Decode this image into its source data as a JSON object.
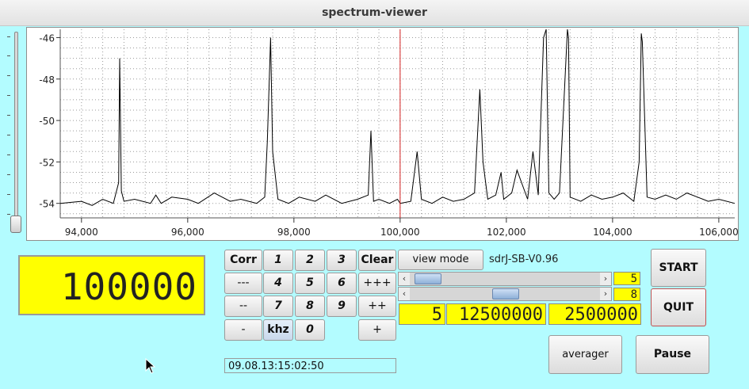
{
  "window": {
    "title": "spectrum-viewer"
  },
  "frequency_display": {
    "value": "100000"
  },
  "keypad": {
    "corr": "Corr",
    "k1": "1",
    "k2": "2",
    "k3": "3",
    "clear": "Clear",
    "dash3": "---",
    "k4": "4",
    "k5": "5",
    "k6": "6",
    "plus3": "+++",
    "dash2": "--",
    "k7": "7",
    "k8": "8",
    "k9": "9",
    "plus2": "++",
    "dash1": "-",
    "khz": "khz",
    "k0": "0",
    "plus1": "+"
  },
  "controls": {
    "view_mode": "view mode",
    "version": "sdrJ-SB-V0.96",
    "scroll1_value": "5",
    "scroll2_value": "8",
    "lcd_small": "5",
    "lcd_rate1": "12500000",
    "lcd_rate2": "2500000",
    "start": "START",
    "quit": "QUIT",
    "averager": "averager",
    "pause": "Pause",
    "datetime": "09.08.13:15:02:50"
  },
  "chart_data": {
    "type": "line",
    "xlim": [
      93600,
      106300
    ],
    "ylim": [
      -54.7,
      -45.6
    ],
    "x_ticks": [
      94000,
      96000,
      98000,
      100000,
      102000,
      104000,
      106000
    ],
    "x_tick_labels": [
      "94,000",
      "96,000",
      "98,000",
      "100,000",
      "102,000",
      "104,000",
      "106,000"
    ],
    "y_ticks": [
      -46,
      -48,
      -50,
      -52,
      -54
    ],
    "y_tick_labels": [
      "-46",
      "-48",
      "-50",
      "-52",
      "-54"
    ],
    "marker_x": 100000,
    "grid": true,
    "series": [
      {
        "x": [
          93600,
          94000,
          94200,
          94400,
          94600,
          94700,
          94720,
          94750,
          94800,
          95000,
          95300,
          95400,
          95500,
          95700,
          96000,
          96200,
          96500,
          96800,
          97000,
          97300,
          97450,
          97500,
          97560,
          97600,
          97700,
          97900,
          98100,
          98400,
          98600,
          98900,
          99200,
          99400,
          99450,
          99500,
          99600,
          99800,
          99950,
          100000,
          100200,
          100320,
          100400,
          100600,
          100800,
          101000,
          101200,
          101400,
          101500,
          101560,
          101650,
          101800,
          101900,
          101950,
          102100,
          102200,
          102400,
          102500,
          102600,
          102700,
          102750,
          102800,
          102900,
          103000,
          103150,
          103170,
          103200,
          103400,
          103600,
          103800,
          104000,
          104200,
          104400,
          104500,
          104540,
          104560,
          104650,
          104800,
          105000,
          105200,
          105400,
          105600,
          105800,
          106000,
          106300
        ],
        "y": [
          -54,
          -53.9,
          -54.1,
          -53.8,
          -54,
          -53,
          -47,
          -53.4,
          -53.9,
          -53.8,
          -54,
          -53.6,
          -54,
          -53.7,
          -53.8,
          -54,
          -53.5,
          -53.9,
          -53.8,
          -54,
          -53.7,
          -51,
          -46,
          -51.5,
          -53.8,
          -54,
          -53.7,
          -53.9,
          -53.6,
          -54,
          -53.8,
          -53.6,
          -50.5,
          -53.9,
          -53.8,
          -54,
          -53.8,
          -54,
          -53.9,
          -51.5,
          -53.8,
          -54,
          -53.7,
          -53.9,
          -53.8,
          -53.5,
          -48.5,
          -52,
          -53.8,
          -53.6,
          -52.5,
          -53.8,
          -53.5,
          -52.4,
          -53.8,
          -51.5,
          -53.6,
          -46,
          -45.6,
          -53.5,
          -53.8,
          -53.5,
          -45.6,
          -46,
          -53.7,
          -53.9,
          -53.6,
          -53.8,
          -53.7,
          -53.5,
          -53.9,
          -52,
          -45.8,
          -46.2,
          -53.7,
          -53.8,
          -53.6,
          -53.8,
          -53.5,
          -53.7,
          -53.9,
          -53.8,
          -54
        ]
      }
    ]
  }
}
